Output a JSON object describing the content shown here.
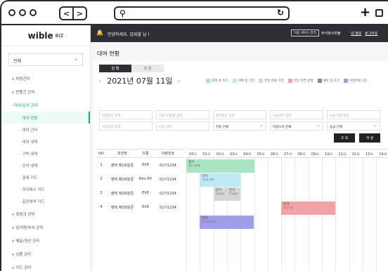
{
  "browser": {
    "nav_back": "<",
    "nav_fwd": ">",
    "search_icon": "search-icon",
    "reload_icon": "reload-icon",
    "plus_icon": "+"
  },
  "sidebar": {
    "logo": "wible",
    "logo_sub": "BIZ",
    "company_select": "전체",
    "items": [
      {
        "label": "+ 차량관리",
        "type": "group"
      },
      {
        "label": "+ 반품건 관리",
        "type": "group"
      },
      {
        "label": "- 대여/입차 관리",
        "type": "group-active"
      },
      {
        "label": "· 대여 현황",
        "type": "sub-active"
      },
      {
        "label": "· 대여 관리",
        "type": "sub"
      },
      {
        "label": "· 대여 내역",
        "type": "sub"
      },
      {
        "label": "· 구독 내역",
        "type": "sub"
      },
      {
        "label": "· 공석 내역",
        "type": "sub"
      },
      {
        "label": "· 결제 카드",
        "type": "sub"
      },
      {
        "label": "· 하이패스 카드",
        "type": "sub"
      },
      {
        "label": "· 출장예약 카드",
        "type": "sub"
      },
      {
        "label": "+ 회원과 관리",
        "type": "group"
      },
      {
        "label": "+ 임직원/부서 관리",
        "type": "group"
      },
      {
        "label": "+ 매출/정산 관리",
        "type": "group"
      },
      {
        "label": "+ 상품 관리",
        "type": "group"
      },
      {
        "label": "+ 카드 관리",
        "type": "group"
      }
    ]
  },
  "topbar": {
    "bell": "🔔",
    "greeting": "안녕하세요. 김위블 님 !",
    "btn_switch": "이용 서비스 관리",
    "link1": "주식회사위블",
    "link2": "내 정보",
    "link3": "로그아웃"
  },
  "page": {
    "title": "대여 현황"
  },
  "view_toggle": {
    "day": "일 별",
    "month": "월 별"
  },
  "date": {
    "label": "2021년 07월 11일",
    "prev": "‹",
    "next": "›"
  },
  "legend": [
    {
      "label": "대여 중 조기",
      "color": "#a9e4c4"
    },
    {
      "label": "대여 중 기한",
      "color": "#bde9f3"
    },
    {
      "label": "반납 완료 기한",
      "color": "#d6d6d6"
    },
    {
      "label": "반납 지연 운행",
      "color": "#f2a3a8"
    },
    {
      "label": "예약 중 조기",
      "color": "#8a8a8a"
    },
    {
      "label": "이용완료 1분",
      "color": "#9f9ee8"
    }
  ],
  "filters": {
    "row1": [
      "차량번호 입력",
      "차량 모델/명 입력",
      "렌트번호 입력",
      "사용번호 입력",
      "사용 차량 입력"
    ],
    "row2": [
      "이용번호 입력",
      "이용 입력",
      "차종 전체",
      "차량소속 전체",
      "등급 전체"
    ],
    "search": "조 회",
    "excel": "엑 셀"
  },
  "table": {
    "headers": [
      "NO",
      "회원명",
      "차종",
      "차량번호"
    ],
    "rows": [
      [
        "1",
        "영택 제1회원준",
        "EV6",
        "01가1234"
      ],
      [
        "2",
        "영택 제2회원준",
        "Niro EV",
        "01가1234"
      ],
      [
        "3",
        "영택 제3회원준",
        "EV6",
        "01가1234"
      ],
      [
        "4",
        "영택 제2회원준",
        "EV6",
        "01가1234"
      ]
    ]
  },
  "timeline": {
    "hours": [
      "00시",
      "01시",
      "02시",
      "03시",
      "04시",
      "05시",
      "06시",
      "07시",
      "08시",
      "09시",
      "10시",
      "11시",
      "12시",
      "13시",
      "14시"
    ],
    "bars": [
      {
        "title": "장기",
        "sub": "일반 예약중",
        "color": "#a9e4c4",
        "start": 0,
        "end": 5,
        "row": 0
      },
      {
        "title": "단기",
        "sub": "대여중 대여",
        "color": "#bde9f3",
        "start": 1,
        "end": 4,
        "row": 1
      },
      {
        "title": "단기",
        "sub": "반납완료",
        "color": "#d6d6d6",
        "start": 2,
        "end": 3,
        "row": 2
      },
      {
        "title": "단기",
        "sub": "반납완료",
        "color": "#d6d6d6",
        "start": 3,
        "end": 4,
        "row": 2
      },
      {
        "title": "단기",
        "sub": "반납 연장",
        "color": "#f2a3a8",
        "start": 7,
        "end": 11,
        "row": 3
      },
      {
        "title": "단기",
        "sub": "이용완료 대여",
        "color": "#9f9ee8",
        "start": 1,
        "end": 5,
        "row": 4
      }
    ]
  }
}
